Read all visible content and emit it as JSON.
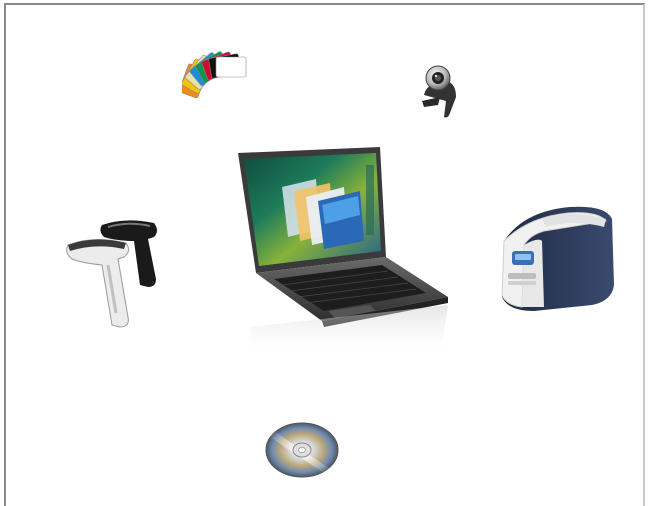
{
  "components": [
    {
      "id": "color-cards",
      "icon": "color-card-fan-icon"
    },
    {
      "id": "webcam",
      "icon": "webcam-icon"
    },
    {
      "id": "laptop",
      "icon": "laptop-icon"
    },
    {
      "id": "barcode-scanners",
      "icon": "barcode-scanner-icon"
    },
    {
      "id": "card-printer",
      "icon": "card-printer-icon"
    },
    {
      "id": "software-cd",
      "icon": "cd-disc-icon"
    }
  ],
  "card_colors": [
    "#f28a1a",
    "#f5c400",
    "#e8e0b0",
    "#1a8fd8",
    "#12924a",
    "#c8102e",
    "#111111",
    "#ffffff"
  ],
  "accent_colors": {
    "frame": "#8a8a8a",
    "printer_body": "#2d3a55",
    "printer_shell": "#f2f2f2"
  }
}
